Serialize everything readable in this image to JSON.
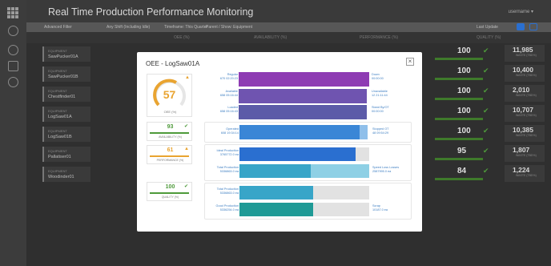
{
  "header": {
    "title": "Real Time Production Performance Monitoring",
    "user": "username ▾"
  },
  "filter": {
    "f1": "Advanced Filter",
    "f2": "Any Shift (Including Idle)",
    "f3": "Timeframe: This Quarter",
    "f4": "Parent / Show: Equipment",
    "refresh": "Last Update"
  },
  "columns": {
    "c1": "OEE (%)",
    "c2": "AVAILABILITY (%)",
    "c3": "PERFORMANCE (%)",
    "c4": "QUALITY (%)"
  },
  "rows": [
    {
      "type": "EQUIPMENT",
      "name": "SawPucker01A",
      "quality": "100",
      "count": "11,985",
      "unit": "WASTE\n(TBD%)"
    },
    {
      "type": "EQUIPMENT",
      "name": "SawPucker01B",
      "quality": "100",
      "count": "10,400",
      "unit": "WASTE\n(TBD%)"
    },
    {
      "type": "EQUIPMENT",
      "name": "Chestfinder01",
      "quality": "100",
      "count": "2,010",
      "unit": "WASTE\n(TBD%)"
    },
    {
      "type": "EQUIPMENT",
      "name": "LogSaw01A",
      "quality": "100",
      "count": "10,707",
      "unit": "WASTE\n(TBD%)"
    },
    {
      "type": "EQUIPMENT",
      "name": "LogSaw01B",
      "quality": "100",
      "count": "10,385",
      "unit": "WASTE\n(TBD%)"
    },
    {
      "type": "EQUIPMENT",
      "name": "Pallatiser01",
      "quality": "95",
      "count": "1,807",
      "unit": "WASTE\n(TBD%)"
    },
    {
      "type": "EQUIPMENT",
      "name": "Woodinder01",
      "quality": "84",
      "count": "1,224",
      "unit": "WASTE\n(TBD%)"
    }
  ],
  "modal": {
    "title": "OEE - LogSaw01A",
    "close": "×",
    "oee": {
      "value": "57",
      "label": "OEE (%)"
    },
    "availability": {
      "value": "93",
      "label": "AVAILABILITY (%)"
    },
    "performance": {
      "value": "61",
      "label": "PERFORMANCE (%)"
    },
    "quality": {
      "value": "100",
      "label": "QUALITY (%)"
    },
    "time": {
      "regular_label": "Regular",
      "regular_value": "670 02:20:23",
      "available_label": "Available",
      "available_value": "658 05:16:44",
      "loaded_label": "Loaded",
      "loaded_value": "658 05:16:43",
      "operated_label": "Operated",
      "operated_value": "608 19:34:14",
      "down_label": "Down",
      "down_value": "00:00:00",
      "unavailable_label": "Unavailable",
      "unavailable_value": "12 21:11:44",
      "standby_label": "Stand By/OT",
      "standby_value": "00:00:00",
      "stopped_label": "Stopped OT",
      "stopped_value": "48 09:54:29"
    },
    "production": {
      "ideal_label": "Ideal Production",
      "ideal_value": "3765772.0 ea",
      "total_label": "Total Production",
      "total_value": "5336863.0 ea",
      "speedloss_label": "Speed Loss Losses",
      "speedloss_value": "2587995.0 ea"
    },
    "quality_block": {
      "total_label": "Total Production",
      "total_value": "5336863.0 ea",
      "good_label": "Good Production",
      "good_value": "5336254.0 ea",
      "scrap_label": "Scrap",
      "scrap_value": "10187.0 ea"
    },
    "fill": {
      "regular": 1.0,
      "available": 0.98,
      "loaded": 0.98,
      "operated": 0.92,
      "ideal": 0.89,
      "total_prod": 1.0,
      "total_q": 0.58,
      "good_q": 0.58
    }
  },
  "colors": {
    "accent": "#e9a431",
    "good": "#4e9a3a",
    "regular": "#8e3bb3",
    "available": "#6f54b0",
    "loaded": "#5c5ba8",
    "operated": "#3a86d6",
    "ideal": "#2a6fd0",
    "total": "#38a5c8",
    "good_prod": "#1f9a96"
  }
}
